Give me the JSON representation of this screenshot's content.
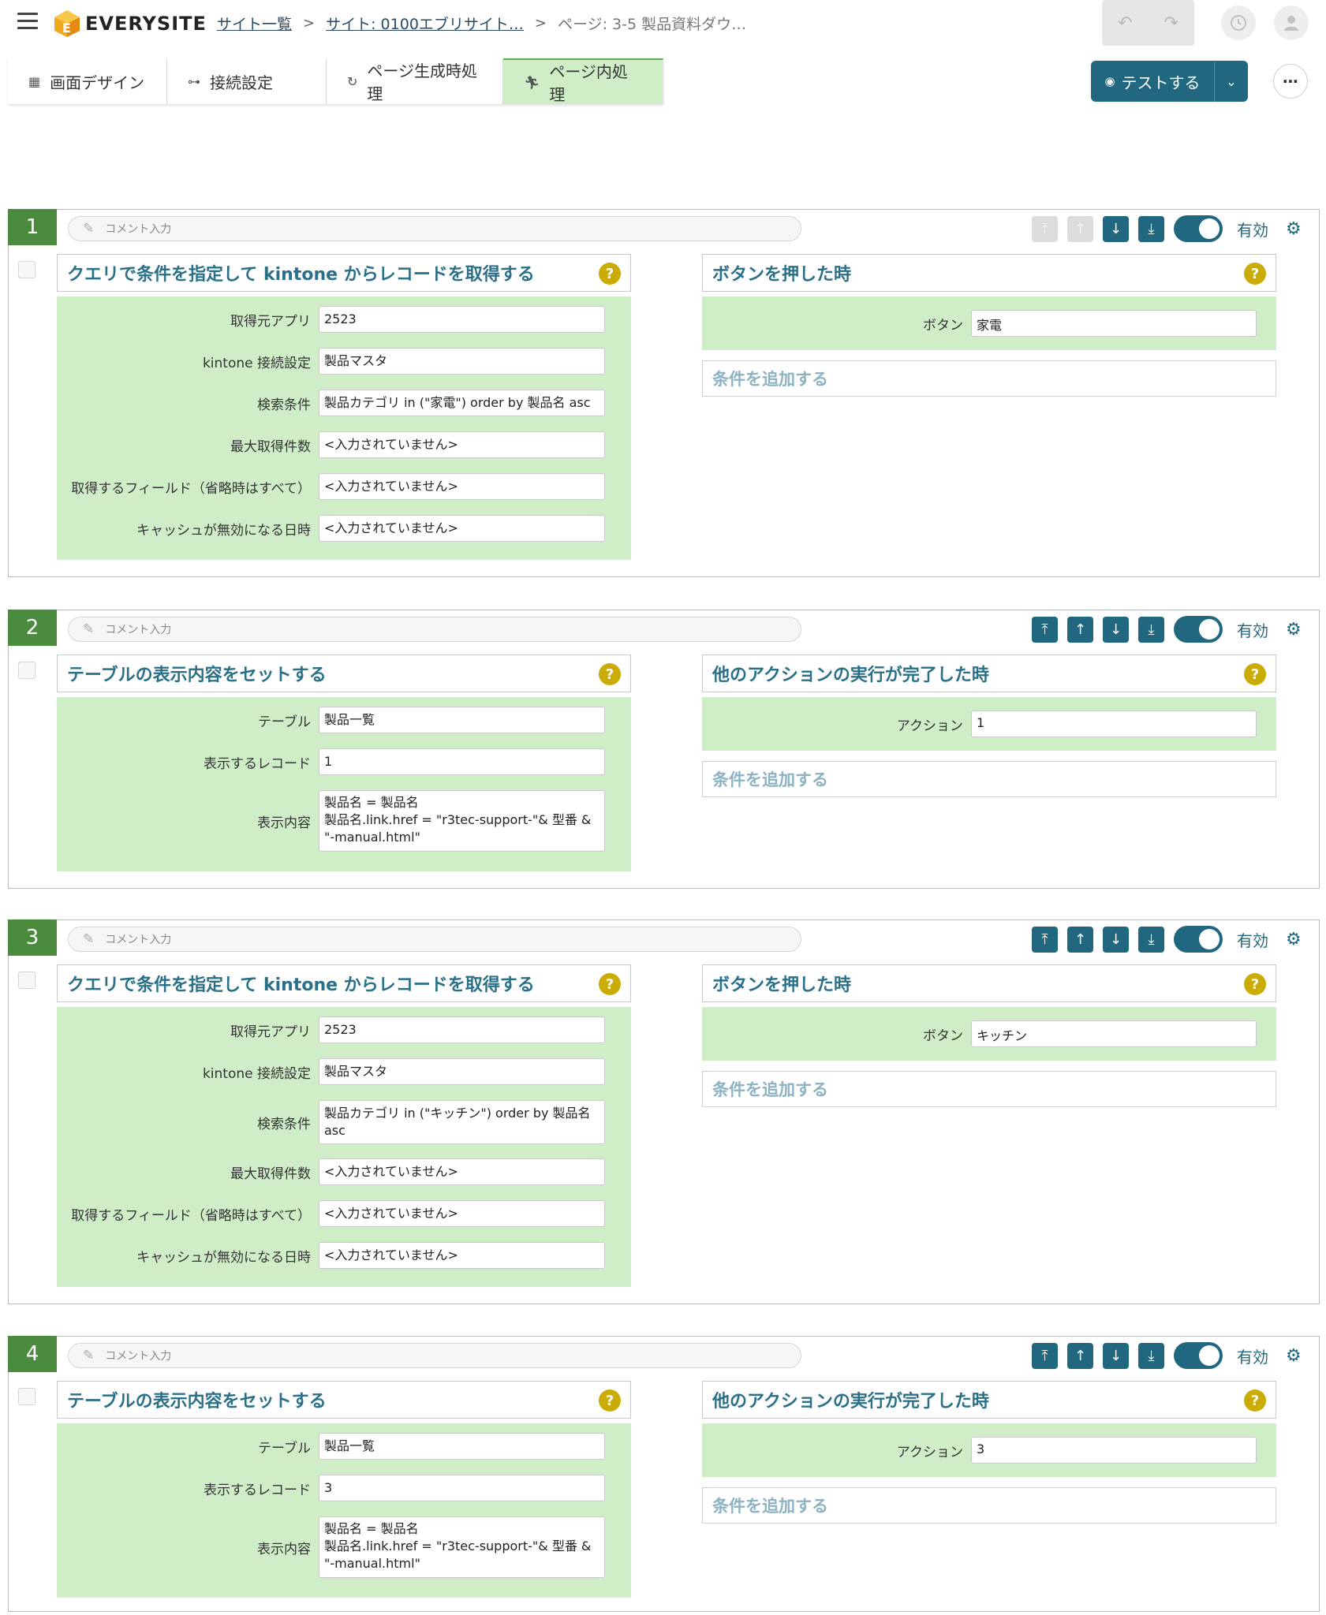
{
  "header": {
    "logo_text": "EVERYSITE",
    "breadcrumb": [
      {
        "label": "サイト一覧"
      },
      {
        "label": "サイト: 0100エブリサイト…"
      },
      {
        "label": "ページ: 3-5 製品資料ダウ…"
      }
    ],
    "undo_icon": "undo-icon",
    "redo_icon": "redo-icon",
    "history_icon": "history-icon",
    "user_icon": "user-icon"
  },
  "tabs": [
    {
      "label": "画面デザイン",
      "icon": "layout-icon",
      "active": false
    },
    {
      "label": "接続設定",
      "icon": "connection-icon",
      "active": false
    },
    {
      "label": "ページ生成時処理",
      "icon": "refresh-icon",
      "active": false
    },
    {
      "label": "ページ内処理",
      "icon": "run-icon",
      "active": true
    }
  ],
  "test_button": {
    "label": "テストする"
  },
  "colors": {
    "accent": "#20677f",
    "green_fill": "#cfeec8",
    "number_badge": "#4a8b3d",
    "help_badge": "#cbab06"
  },
  "comment_placeholder": "コメント入力",
  "enabled_label": "有効",
  "add_condition_label": "条件を追加する",
  "blocks": [
    {
      "number": "1",
      "action_title": "クエリで条件を指定して kintone からレコードを取得する",
      "fields": [
        {
          "label": "取得元アプリ",
          "value": "2523"
        },
        {
          "label": "kintone 接続設定",
          "value": "製品マスタ"
        },
        {
          "label": "検索条件",
          "value": "製品カテゴリ in (\"家電\") order by 製品名 asc"
        },
        {
          "label": "最大取得件数",
          "value": "<入力されていません>"
        },
        {
          "label": "取得するフィールド（省略時はすべて）",
          "value": "<入力されていません>"
        },
        {
          "label": "キャッシュが無効になる日時",
          "value": "<入力されていません>"
        }
      ],
      "trigger_title": "ボタンを押した時",
      "trigger_field": {
        "label": "ボタン",
        "value": "家電"
      }
    },
    {
      "number": "2",
      "action_title": "テーブルの表示内容をセットする",
      "fields": [
        {
          "label": "テーブル",
          "value": "製品一覧"
        },
        {
          "label": "表示するレコード",
          "value": "1"
        },
        {
          "label": "表示内容",
          "value": "製品名 = 製品名\n製品名.link.href = \"r3tec-support-\"& 型番 &\n\"-manual.html\""
        }
      ],
      "trigger_title": "他のアクションの実行が完了した時",
      "trigger_field": {
        "label": "アクション",
        "value": "1"
      }
    },
    {
      "number": "3",
      "action_title": "クエリで条件を指定して kintone からレコードを取得する",
      "fields": [
        {
          "label": "取得元アプリ",
          "value": "2523"
        },
        {
          "label": "kintone 接続設定",
          "value": "製品マスタ"
        },
        {
          "label": "検索条件",
          "value": "製品カテゴリ in (\"キッチン\") order by 製品名\nasc"
        },
        {
          "label": "最大取得件数",
          "value": "<入力されていません>"
        },
        {
          "label": "取得するフィールド（省略時はすべて）",
          "value": "<入力されていません>"
        },
        {
          "label": "キャッシュが無効になる日時",
          "value": "<入力されていません>"
        }
      ],
      "trigger_title": "ボタンを押した時",
      "trigger_field": {
        "label": "ボタン",
        "value": "キッチン"
      }
    },
    {
      "number": "4",
      "action_title": "テーブルの表示内容をセットする",
      "fields": [
        {
          "label": "テーブル",
          "value": "製品一覧"
        },
        {
          "label": "表示するレコード",
          "value": "3"
        },
        {
          "label": "表示内容",
          "value": "製品名 = 製品名\n製品名.link.href = \"r3tec-support-\"& 型番 &\n\"-manual.html\""
        }
      ],
      "trigger_title": "他のアクションの実行が完了した時",
      "trigger_field": {
        "label": "アクション",
        "value": "3"
      }
    }
  ]
}
